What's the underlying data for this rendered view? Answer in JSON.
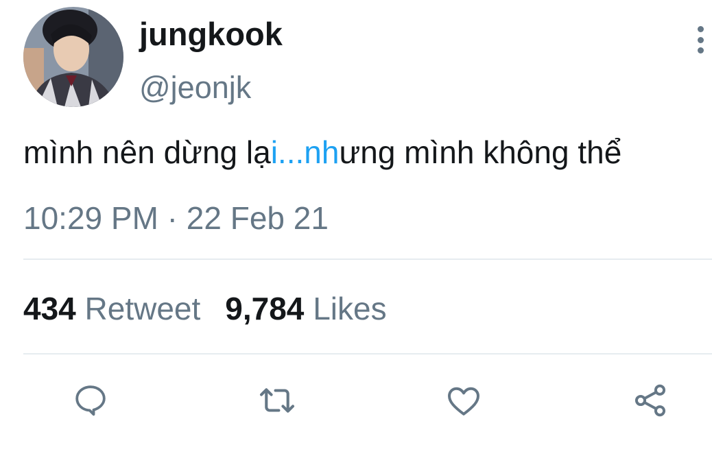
{
  "user": {
    "display_name": "jungkook",
    "handle": "@jeonjk"
  },
  "tweet": {
    "text_part1": "mình nên dừng lạ",
    "text_highlight1": "i...nh",
    "text_part2": "ưng mình không thể",
    "timestamp": "10:29 PM · 22 Feb 21"
  },
  "stats": {
    "retweet_count": "434",
    "retweet_label": "Retweet",
    "likes_count": "9,784",
    "likes_label": "Likes"
  },
  "actions": {
    "reply_icon": "reply-icon",
    "retweet_icon": "retweet-icon",
    "like_icon": "heart-icon",
    "share_icon": "share-icon"
  },
  "colors": {
    "text": "#14171a",
    "secondary": "#657786",
    "link": "#1da1f2",
    "divider": "#e6ecf0"
  }
}
